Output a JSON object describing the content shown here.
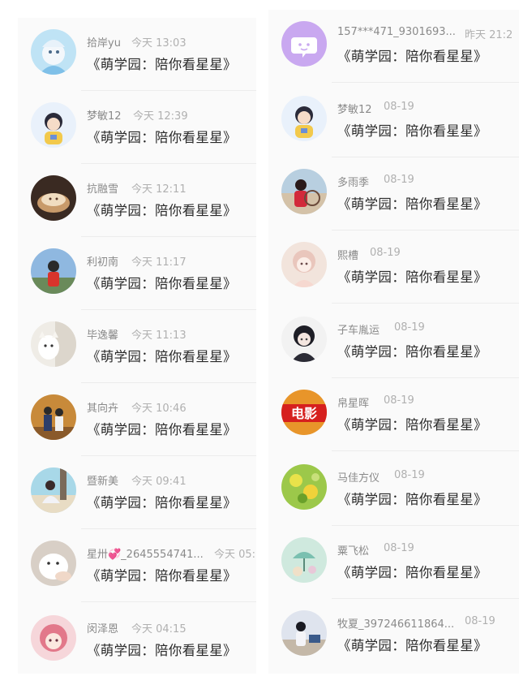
{
  "left_column": [
    {
      "name": "拾岸yu",
      "time": "今天 13:03",
      "message": "《萌学园：陪你看星星》"
    },
    {
      "name": "梦敏12",
      "time": "今天 12:39",
      "message": "《萌学园：陪你看星星》"
    },
    {
      "name": "抗融雪",
      "time": "今天 12:11",
      "message": "《萌学园：陪你看星星》"
    },
    {
      "name": "利初南",
      "time": "今天 11:17",
      "message": "《萌学园：陪你看星星》"
    },
    {
      "name": "毕逸馨",
      "time": "今天 11:13",
      "message": "《萌学园：陪你看星星》"
    },
    {
      "name": "其向卉",
      "time": "今天 10:46",
      "message": "《萌学园：陪你看星星》"
    },
    {
      "name": "暨新美",
      "time": "今天 09:41",
      "message": "《萌学园：陪你看星星》"
    },
    {
      "name": "星卅💞_2645554741...",
      "time": "今天 05:",
      "message": "《萌学园：陪你看星星》"
    },
    {
      "name": "闵泽恩",
      "time": "今天 04:15",
      "message": "《萌学园：陪你看星星》"
    }
  ],
  "right_column": [
    {
      "name": "157***471_9301693...",
      "time": "昨天 21:2",
      "message": "《萌学园：陪你看星星》"
    },
    {
      "name": "梦敏12",
      "time": "08-19",
      "message": "《萌学园：陪你看星星》"
    },
    {
      "name": "多雨季",
      "time": "08-19",
      "message": "《萌学园：陪你看星星》"
    },
    {
      "name": "熙槽",
      "time": "08-19",
      "message": "《萌学园：陪你看星星》"
    },
    {
      "name": "子车胤运",
      "time": "08-19",
      "message": "《萌学园：陪你看星星》"
    },
    {
      "name": "帛星晖",
      "time": "08-19",
      "message": "《萌学园：陪你看星星》"
    },
    {
      "name": "马佳方仪",
      "time": "08-19",
      "message": "《萌学园：陪你看星星》"
    },
    {
      "name": "粟飞松",
      "time": "08-19",
      "message": "《萌学园：陪你看星星》"
    },
    {
      "name": "牧夏_397246611864...",
      "time": "08-19",
      "message": "《萌学园：陪你看星星》"
    }
  ],
  "avatar_badge_text": "电影",
  "colors": {
    "background": "#fafafa",
    "divider": "#ececec",
    "name": "#8a8a8a",
    "time": "#b0b0b0",
    "message": "#2a2a2a",
    "default_avatar": "#c9a8f0"
  }
}
